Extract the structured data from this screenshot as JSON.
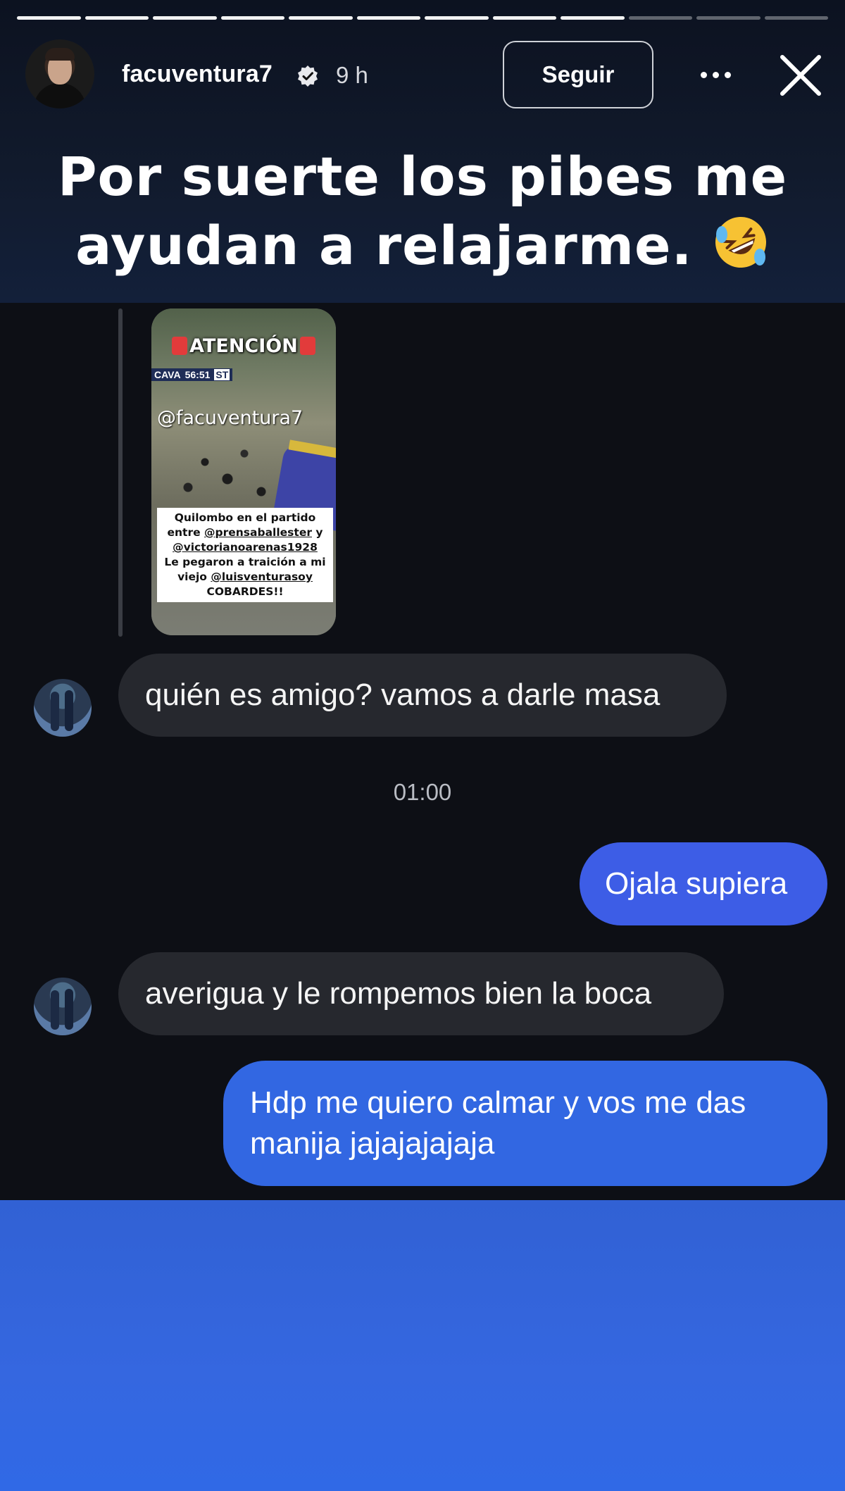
{
  "story": {
    "progress_total": 12,
    "progress_done": 9,
    "username": "facuventura7",
    "time_ago": "9 h",
    "follow_label": "Seguir",
    "caption_line1": "Por suerte los pibes me",
    "caption_line2": "ayudan a relajarme.",
    "caption_emoji": "rolling-on-floor-laughing"
  },
  "shared_story": {
    "banner": "ATENCIÓN",
    "score_team": "CAVA",
    "score_time": "56:51",
    "score_label": "ST",
    "handle": "@facuventura7",
    "text_line1": "Quilombo en el partido",
    "text_line2_prefix": "entre ",
    "text_line2_mention": "@prensaballester",
    "text_line2_suffix": " y",
    "text_line3": "@victorianoarenas1928",
    "text_line4": "Le pegaron a traición a mi",
    "text_line5_prefix": "viejo ",
    "text_line5_mention": "@luisventurasoy",
    "text_line6": "COBARDES!!"
  },
  "messages": [
    {
      "from": "other",
      "text": "quién es amigo? vamos a darle masa"
    },
    {
      "from": "me",
      "text": "Ojala supiera"
    },
    {
      "from": "other",
      "text": "averigua y le rompemos bien la boca"
    },
    {
      "from": "me",
      "text": "Hdp me quiero calmar y vos me das manija jajajajajaja"
    }
  ],
  "timestamp": "01:00",
  "colors": {
    "outgoing_bubble": "#3c5fe6",
    "incoming_bubble": "#26282e",
    "background": "#0d0f15"
  }
}
